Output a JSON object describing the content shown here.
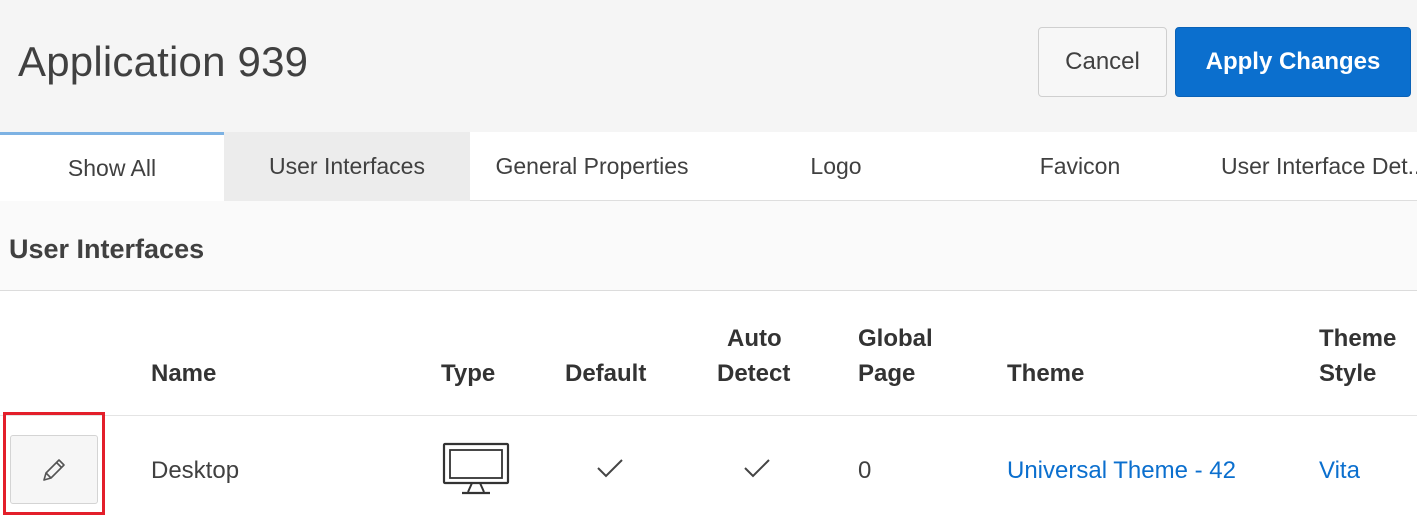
{
  "header": {
    "title": "Application 939",
    "cancel_label": "Cancel",
    "apply_label": "Apply Changes"
  },
  "tabs": [
    {
      "label": "Show All"
    },
    {
      "label": "User Interfaces"
    },
    {
      "label": "General Properties"
    },
    {
      "label": "Logo"
    },
    {
      "label": "Favicon"
    },
    {
      "label": "User Interface Det..."
    }
  ],
  "region": {
    "title": "User Interfaces"
  },
  "table": {
    "columns": {
      "name": "Name",
      "type": "Type",
      "default": "Default",
      "auto_detect_1": "Auto",
      "auto_detect_2": "Detect",
      "global_page_1": "Global",
      "global_page_2": "Page",
      "theme": "Theme",
      "theme_style_1": "Theme",
      "theme_style_2": "Style"
    },
    "rows": [
      {
        "name": "Desktop",
        "type_icon": "monitor-icon",
        "default_icon": "checkmark-icon",
        "auto_detect_icon": "checkmark-icon",
        "global_page": "0",
        "theme": "Universal Theme - 42",
        "theme_style": "Vita"
      }
    ]
  },
  "colors": {
    "primary": "#0b6fce",
    "highlight": "#e31f2a",
    "active_tab_indicator": "#7db2e3"
  }
}
